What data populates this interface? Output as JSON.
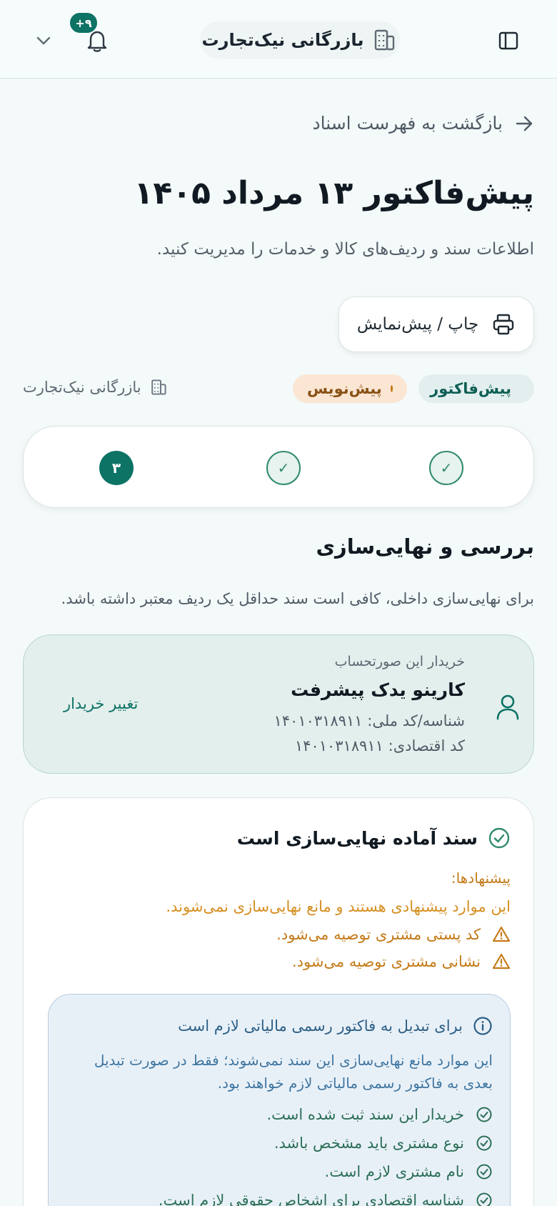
{
  "header": {
    "brand_name": "بازرگانی نیک‌تجارت",
    "notification_count": "۹+"
  },
  "nav": {
    "back_label": "بازگشت به فهرست اسناد"
  },
  "page": {
    "title": "پیش‌فاکتور ۱۳ مرداد ۱۴۰۵",
    "subtitle": "اطلاعات سند و ردیف‌های کالا و خدمات را مدیریت کنید.",
    "print_label": "چاپ / پیش‌نمایش"
  },
  "badges": {
    "doc_type": "پیش‌فاکتور",
    "doc_status": "پیش‌نویس",
    "organization": "بازرگانی نیک‌تجارت"
  },
  "stepper": {
    "current_step": "۳",
    "done_mark": "✓"
  },
  "review": {
    "title": "بررسی و نهایی‌سازی",
    "description": "برای نهایی‌سازی داخلی، کافی است سند حداقل یک ردیف معتبر داشته باشد."
  },
  "buyer": {
    "caption": "خریدار این صورتحساب",
    "name": "کارینو یدک پیشرفت",
    "national_id": "شناسه/کد ملی: ۱۴۰۱۰۳۱۸۹۱۱",
    "economic_code": "کد اقتصادی: ۱۴۰۱۰۳۱۸۹۱۱",
    "change_label": "تغییر خریدار"
  },
  "validation": {
    "title": "سند آماده نهایی‌سازی است",
    "suggestions_label": "پیشنهادها:",
    "suggestions_intro": "این موارد پیشنهادی هستند و مانع نهایی‌سازی نمی‌شوند.",
    "suggestions": [
      "کد پستی مشتری توصیه می‌شود.",
      "نشانی مشتری توصیه می‌شود."
    ],
    "tax_box": {
      "title": "برای تبدیل به فاکتور رسمی مالیاتی لازم است",
      "body": "این موارد مانع نهایی‌سازی این سند نمی‌شوند؛ فقط در صورت تبدیل بعدی به فاکتور رسمی مالیاتی لازم خواهند بود.",
      "requirements": [
        "خریدار این سند ثبت شده است.",
        "نوع مشتری باید مشخص باشد.",
        "نام مشتری لازم است.",
        "شناسه اقتصادی برای اشخاص حقوقی لازم است."
      ]
    }
  },
  "colors": {
    "accent": "#0c7365",
    "warning": "#c47a18",
    "info": "#2c5f87",
    "success": "#2c6f57"
  },
  "icons": {
    "panel": "sidebar-toggle-icon",
    "brand": "building-icon",
    "bell": "bell-icon",
    "chevron": "chevron-down-icon",
    "back": "arrow-right-icon",
    "print": "printer-icon",
    "user": "user-icon",
    "check": "check-circle-icon",
    "warning": "warning-triangle-icon",
    "info": "info-circle-icon"
  }
}
